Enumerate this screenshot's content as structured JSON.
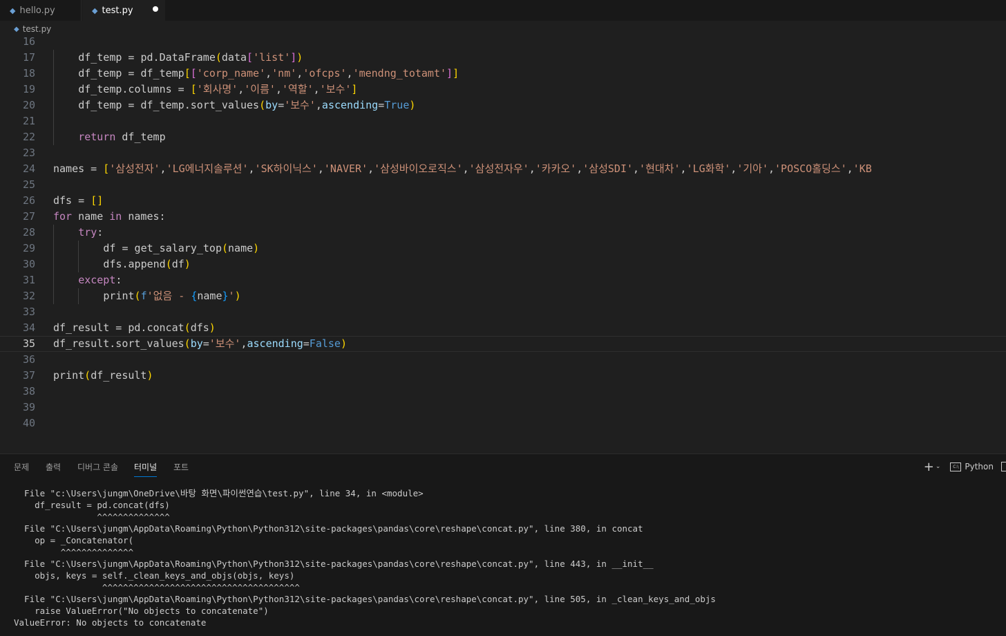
{
  "tabs": [
    {
      "label": "hello.py",
      "icon": "python-icon"
    },
    {
      "label": "test.py",
      "icon": "python-icon",
      "active": true,
      "modified": true
    }
  ],
  "breadcrumb": {
    "file": "test.py"
  },
  "editor": {
    "current_line": 35,
    "lines": [
      {
        "n": "16",
        "tokens": []
      },
      {
        "n": "17",
        "indent": 1,
        "tokens": [
          [
            "df_temp = pd.DataFrame",
            "var"
          ],
          [
            "(",
            "b1"
          ],
          [
            "data",
            "var"
          ],
          [
            "[",
            "b2"
          ],
          [
            "'list'",
            "str"
          ],
          [
            "]",
            "b2"
          ],
          [
            ")",
            "b1"
          ]
        ]
      },
      {
        "n": "18",
        "indent": 1,
        "tokens": [
          [
            "df_temp = df_temp",
            "var"
          ],
          [
            "[",
            "b1"
          ],
          [
            "[",
            "b2"
          ],
          [
            "'corp_name'",
            "str"
          ],
          [
            ",",
            "var"
          ],
          [
            "'nm'",
            "str"
          ],
          [
            ",",
            "var"
          ],
          [
            "'ofcps'",
            "str"
          ],
          [
            ",",
            "var"
          ],
          [
            "'mendng_totamt'",
            "str"
          ],
          [
            "]",
            "b2"
          ],
          [
            "]",
            "b1"
          ]
        ]
      },
      {
        "n": "19",
        "indent": 1,
        "tokens": [
          [
            "df_temp.columns = ",
            "var"
          ],
          [
            "[",
            "b1"
          ],
          [
            "'회사명'",
            "str"
          ],
          [
            ",",
            "var"
          ],
          [
            "'이름'",
            "str"
          ],
          [
            ",",
            "var"
          ],
          [
            "'역할'",
            "str"
          ],
          [
            ",",
            "var"
          ],
          [
            "'보수'",
            "str"
          ],
          [
            "]",
            "b1"
          ]
        ]
      },
      {
        "n": "20",
        "indent": 1,
        "tokens": [
          [
            "df_temp = df_temp.sort_values",
            "var"
          ],
          [
            "(",
            "b1"
          ],
          [
            "by",
            "param"
          ],
          [
            "=",
            "var"
          ],
          [
            "'보수'",
            "str"
          ],
          [
            ",",
            "var"
          ],
          [
            "ascending",
            "param"
          ],
          [
            "=",
            "var"
          ],
          [
            "True",
            "blue"
          ],
          [
            ")",
            "b1"
          ]
        ]
      },
      {
        "n": "21",
        "indent": 1,
        "tokens": []
      },
      {
        "n": "22",
        "indent": 1,
        "tokens": [
          [
            "return",
            "kw"
          ],
          [
            " df_temp",
            "var"
          ]
        ]
      },
      {
        "n": "23",
        "tokens": []
      },
      {
        "n": "24",
        "tokens": [
          [
            "names = ",
            "var"
          ],
          [
            "[",
            "b1"
          ],
          [
            "'삼성전자'",
            "str"
          ],
          [
            ",",
            "var"
          ],
          [
            "'LG에너지솔루션'",
            "str"
          ],
          [
            ",",
            "var"
          ],
          [
            "'SK하이닉스'",
            "str"
          ],
          [
            ",",
            "var"
          ],
          [
            "'NAVER'",
            "str"
          ],
          [
            ",",
            "var"
          ],
          [
            "'삼성바이오로직스'",
            "str"
          ],
          [
            ",",
            "var"
          ],
          [
            "'삼성전자우'",
            "str"
          ],
          [
            ",",
            "var"
          ],
          [
            "'카카오'",
            "str"
          ],
          [
            ",",
            "var"
          ],
          [
            "'삼성SDI'",
            "str"
          ],
          [
            ",",
            "var"
          ],
          [
            "'현대차'",
            "str"
          ],
          [
            ",",
            "var"
          ],
          [
            "'LG화학'",
            "str"
          ],
          [
            ",",
            "var"
          ],
          [
            "'기아'",
            "str"
          ],
          [
            ",",
            "var"
          ],
          [
            "'POSCO홀딩스'",
            "str"
          ],
          [
            ",",
            "var"
          ],
          [
            "'KB",
            "str"
          ]
        ]
      },
      {
        "n": "25",
        "tokens": []
      },
      {
        "n": "26",
        "tokens": [
          [
            "dfs = ",
            "var"
          ],
          [
            "[]",
            "b1"
          ]
        ]
      },
      {
        "n": "27",
        "tokens": [
          [
            "for",
            "kw"
          ],
          [
            " name ",
            "var"
          ],
          [
            "in",
            "kw"
          ],
          [
            " names:",
            "var"
          ]
        ]
      },
      {
        "n": "28",
        "indent": 1,
        "tokens": [
          [
            "try",
            "kw"
          ],
          [
            ":",
            "var"
          ]
        ]
      },
      {
        "n": "29",
        "indent": 2,
        "tokens": [
          [
            "df = get_salary_top",
            "var"
          ],
          [
            "(",
            "b1"
          ],
          [
            "name",
            "var"
          ],
          [
            ")",
            "b1"
          ]
        ]
      },
      {
        "n": "30",
        "indent": 2,
        "tokens": [
          [
            "dfs.append",
            "var"
          ],
          [
            "(",
            "b1"
          ],
          [
            "df",
            "var"
          ],
          [
            ")",
            "b1"
          ]
        ]
      },
      {
        "n": "31",
        "indent": 1,
        "tokens": [
          [
            "except",
            "kw"
          ],
          [
            ":",
            "var"
          ]
        ]
      },
      {
        "n": "32",
        "indent": 2,
        "tokens": [
          [
            "print",
            "var"
          ],
          [
            "(",
            "b1"
          ],
          [
            "f",
            "blue"
          ],
          [
            "'없음 - ",
            "str"
          ],
          [
            "{",
            "b3"
          ],
          [
            "name",
            "var"
          ],
          [
            "}",
            "b3"
          ],
          [
            "'",
            "str"
          ],
          [
            ")",
            "b1"
          ]
        ]
      },
      {
        "n": "33",
        "tokens": []
      },
      {
        "n": "34",
        "tokens": [
          [
            "df_result = pd.concat",
            "var"
          ],
          [
            "(",
            "b1"
          ],
          [
            "dfs",
            "var"
          ],
          [
            ")",
            "b1"
          ]
        ]
      },
      {
        "n": "35",
        "tokens": [
          [
            "df_result.sort_values",
            "var"
          ],
          [
            "(",
            "b1"
          ],
          [
            "by",
            "param"
          ],
          [
            "=",
            "var"
          ],
          [
            "'보수'",
            "str"
          ],
          [
            ",",
            "var"
          ],
          [
            "ascending",
            "param"
          ],
          [
            "=",
            "var"
          ],
          [
            "False",
            "blue"
          ],
          [
            ")",
            "b1"
          ]
        ]
      },
      {
        "n": "36",
        "tokens": []
      },
      {
        "n": "37",
        "tokens": [
          [
            "print",
            "var"
          ],
          [
            "(",
            "b1"
          ],
          [
            "df_result",
            "var"
          ],
          [
            ")",
            "b1"
          ]
        ]
      },
      {
        "n": "38",
        "tokens": []
      },
      {
        "n": "39",
        "tokens": []
      },
      {
        "n": "40",
        "tokens": []
      }
    ]
  },
  "panel": {
    "tabs": [
      {
        "label": "문제"
      },
      {
        "label": "출력"
      },
      {
        "label": "디버그 콘솔"
      },
      {
        "label": "터미널",
        "active": true
      },
      {
        "label": "포트"
      }
    ],
    "actions": {
      "new_terminal": "+",
      "dropdown": "⌄",
      "terminal_label": "Python",
      "terminal_glyph": "C:\\"
    },
    "terminal_lines": [
      "  File \"c:\\Users\\jungm\\OneDrive\\바탕 화면\\파이썬연습\\test.py\", line 34, in <module>",
      "    df_result = pd.concat(dfs)",
      "                ^^^^^^^^^^^^^^",
      "  File \"C:\\Users\\jungm\\AppData\\Roaming\\Python\\Python312\\site-packages\\pandas\\core\\reshape\\concat.py\", line 380, in concat",
      "    op = _Concatenator(",
      "         ^^^^^^^^^^^^^^",
      "  File \"C:\\Users\\jungm\\AppData\\Roaming\\Python\\Python312\\site-packages\\pandas\\core\\reshape\\concat.py\", line 443, in __init__",
      "    objs, keys = self._clean_keys_and_objs(objs, keys)",
      "                 ^^^^^^^^^^^^^^^^^^^^^^^^^^^^^^^^^^^^^^",
      "  File \"C:\\Users\\jungm\\AppData\\Roaming\\Python\\Python312\\site-packages\\pandas\\core\\reshape\\concat.py\", line 505, in _clean_keys_and_objs",
      "    raise ValueError(\"No objects to concatenate\")",
      "ValueError: No objects to concatenate"
    ]
  },
  "colors": {
    "background": "#1f1f1f",
    "string": "#ce9178",
    "keyword": "#c586c0",
    "constant": "#569cd6",
    "parameter": "#9cdcfe",
    "bracket1": "#ffd700",
    "bracket2": "#da70d6",
    "bracket3": "#179fff",
    "active_tab_underline": "#0078d4"
  }
}
